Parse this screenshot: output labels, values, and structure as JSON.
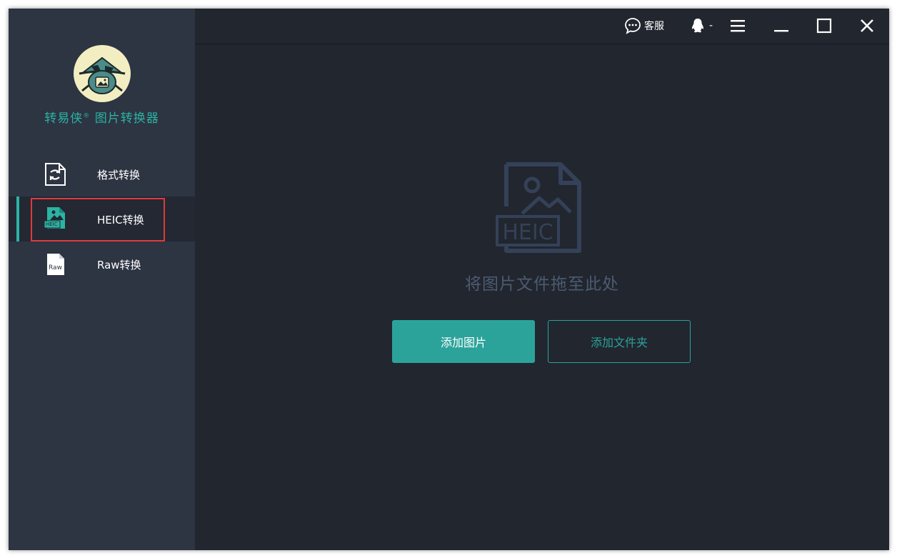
{
  "app": {
    "title": "转易侠",
    "title_mark": "®",
    "title_suffix": " 图片转换器"
  },
  "sidebar": {
    "items": [
      {
        "label": "格式转换",
        "icon": "format-convert-icon",
        "active": false
      },
      {
        "label": "HEIC转换",
        "icon": "heic-icon",
        "active": true
      },
      {
        "label": "Raw转换",
        "icon": "raw-file-icon",
        "active": false
      }
    ]
  },
  "topbar": {
    "support_label": "客服",
    "qq_label": "-"
  },
  "main": {
    "drop_icon_text": "HEIC",
    "drop_hint": "将图片文件拖至此处",
    "add_image_label": "添加图片",
    "add_folder_label": "添加文件夹"
  },
  "colors": {
    "accent": "#2ba39b",
    "sidebar_bg": "#2d3442",
    "main_bg": "#21262f",
    "highlight": "#e03a3a"
  }
}
